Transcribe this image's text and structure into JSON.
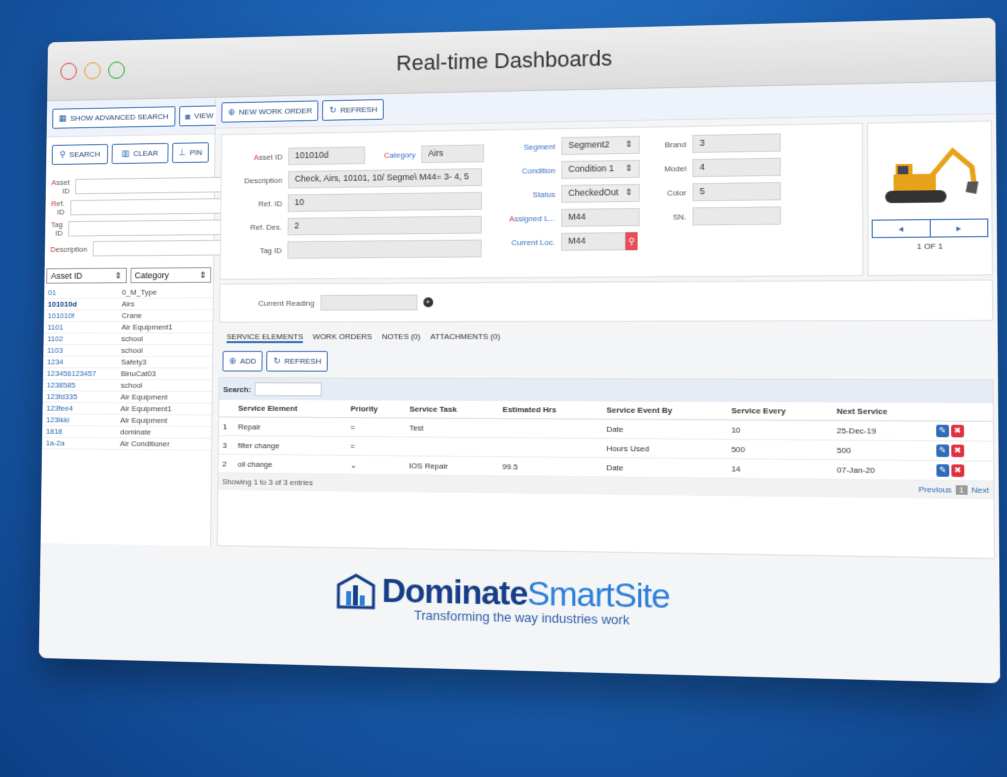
{
  "window": {
    "title": "Real-time Dashboards"
  },
  "sidebar": {
    "show_advanced_search": "SHOW ADVANCED SEARCH",
    "view_image": "VIEW IMAGE",
    "search": "SEARCH",
    "clear": "CLEAR",
    "pin": "PIN",
    "filters": [
      {
        "label_hl": "A",
        "label_rest": "sset ID"
      },
      {
        "label_hl": "R",
        "label_rest": "ef. ID"
      },
      {
        "label_hl": "T",
        "label_rest": "ag ID"
      },
      {
        "label_hl": "D",
        "label_rest": "escription"
      }
    ],
    "select_asset_id": "Asset ID",
    "select_category": "Category",
    "assets": [
      {
        "id": "01",
        "category": "0_M_Type"
      },
      {
        "id": "101010d",
        "category": "Airs"
      },
      {
        "id": "101010f",
        "category": "Crane"
      },
      {
        "id": "1101",
        "category": "Air Equipment1"
      },
      {
        "id": "1102",
        "category": "school"
      },
      {
        "id": "1103",
        "category": "school"
      },
      {
        "id": "1234",
        "category": "Safety3"
      },
      {
        "id": "123456123457",
        "category": "BinuCat03"
      },
      {
        "id": "1238585",
        "category": "school"
      },
      {
        "id": "123fd335",
        "category": "Air Equipment"
      },
      {
        "id": "123fee4",
        "category": "Air Equipment1"
      },
      {
        "id": "123ikki",
        "category": "Air Equipment"
      },
      {
        "id": "1818",
        "category": "dominate"
      },
      {
        "id": "1a-2a",
        "category": "Air Conditioner"
      }
    ]
  },
  "toolbar": {
    "new_work_order": "NEW WORK ORDER",
    "refresh": "REFRESH"
  },
  "form": {
    "asset_id_label_hl": "A",
    "asset_id_label_rest": "sset ID",
    "asset_id": "101010d",
    "category_label_hl": "C",
    "category_label_rest": "ategory",
    "category": "Airs",
    "description_label": "Description",
    "description": "Check, Airs, 10101, 10/ Segme\\ M44= 3- 4, 5",
    "ref_id_label": "Ref. ID",
    "ref_id": "10",
    "ref_des_label": "Ref. Des.",
    "ref_des": "2",
    "tag_id_label": "Tag ID",
    "tag_id": "",
    "segment_label": "Segment",
    "segment": "Segment2",
    "condition_label": "Condition",
    "condition": "Condition 1",
    "status_label": "Status",
    "status": "CheckedOut",
    "assigned_label_hl": "A",
    "assigned_label_rest": "ssigned L...",
    "assigned": "M44",
    "current_loc_label": "Current Loc.",
    "current_loc": "M44",
    "brand_label": "Brand",
    "brand": "3",
    "model_label": "Model",
    "model": "4",
    "color_label": "Color",
    "color": "5",
    "sn_label": "SN.",
    "sn": ""
  },
  "image_panel": {
    "prev": "◂",
    "next": "▸",
    "count": "1 OF 1"
  },
  "reading": {
    "label": "Current Reading"
  },
  "tabs": [
    "SERVICE ELEMENTS",
    "WORK ORDERS",
    "NOTES (0)",
    "ATTACHMENTS (0)"
  ],
  "service": {
    "add": "ADD",
    "refresh": "REFRESH",
    "search_label": "Search:",
    "columns": [
      "",
      "Service Element",
      "Priority",
      "Service Task",
      "Estimated Hrs",
      "Service Event By",
      "Service Every",
      "Next Service",
      ""
    ],
    "rows": [
      [
        "1",
        "Repair",
        "=",
        "Test",
        "",
        "Date",
        "10",
        "25-Dec-19"
      ],
      [
        "3",
        "filter change",
        "=",
        "",
        "",
        "Hours Used",
        "500",
        "500"
      ],
      [
        "2",
        "oil change",
        "⌄",
        "IOS Repair",
        "99.5",
        "Date",
        "14",
        "07-Jan-20"
      ]
    ],
    "footer": "Showing 1 to 3 of 3 entries",
    "previous": "Previous",
    "page": "1",
    "next": "Next"
  },
  "brand": {
    "name_dark": "Dominate",
    "name_light": "SmartSite",
    "tagline": "Transforming the way industries work"
  }
}
